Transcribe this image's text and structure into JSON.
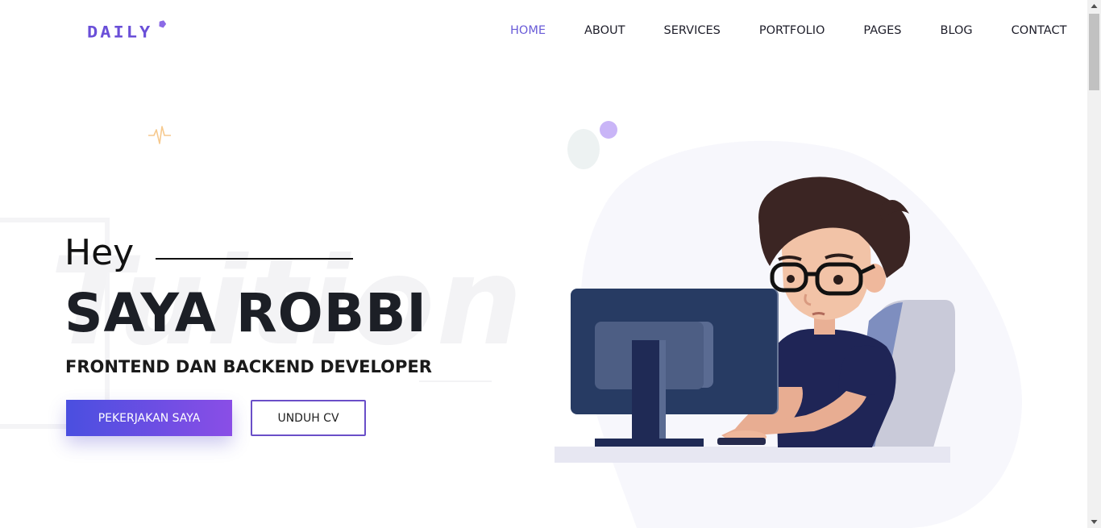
{
  "header": {
    "logo_text": "DAILY",
    "nav": [
      {
        "label": "HOME",
        "active": true
      },
      {
        "label": "ABOUT",
        "active": false
      },
      {
        "label": "SERVICES",
        "active": false
      },
      {
        "label": "PORTFOLIO",
        "active": false
      },
      {
        "label": "PAGES",
        "active": false
      },
      {
        "label": "BLOG",
        "active": false
      },
      {
        "label": "CONTACT",
        "active": false
      }
    ]
  },
  "hero": {
    "greeting": "Hey",
    "name": "SAYA ROBBI",
    "subtitle": "FRONTEND DAN BACKEND DEVELOPER",
    "watermark": "Tuition",
    "primary_button": "PEKERJAKAN SAYA",
    "secondary_button": "UNDUH CV"
  },
  "colors": {
    "accent": "#6a5cd8",
    "button_gradient_start": "#4a4fe0",
    "button_gradient_end": "#8a4ee6",
    "text_dark": "#1c1f26"
  },
  "icons": {
    "pulse": "pulse-icon",
    "logo_mark": "logo-dot-icon"
  }
}
